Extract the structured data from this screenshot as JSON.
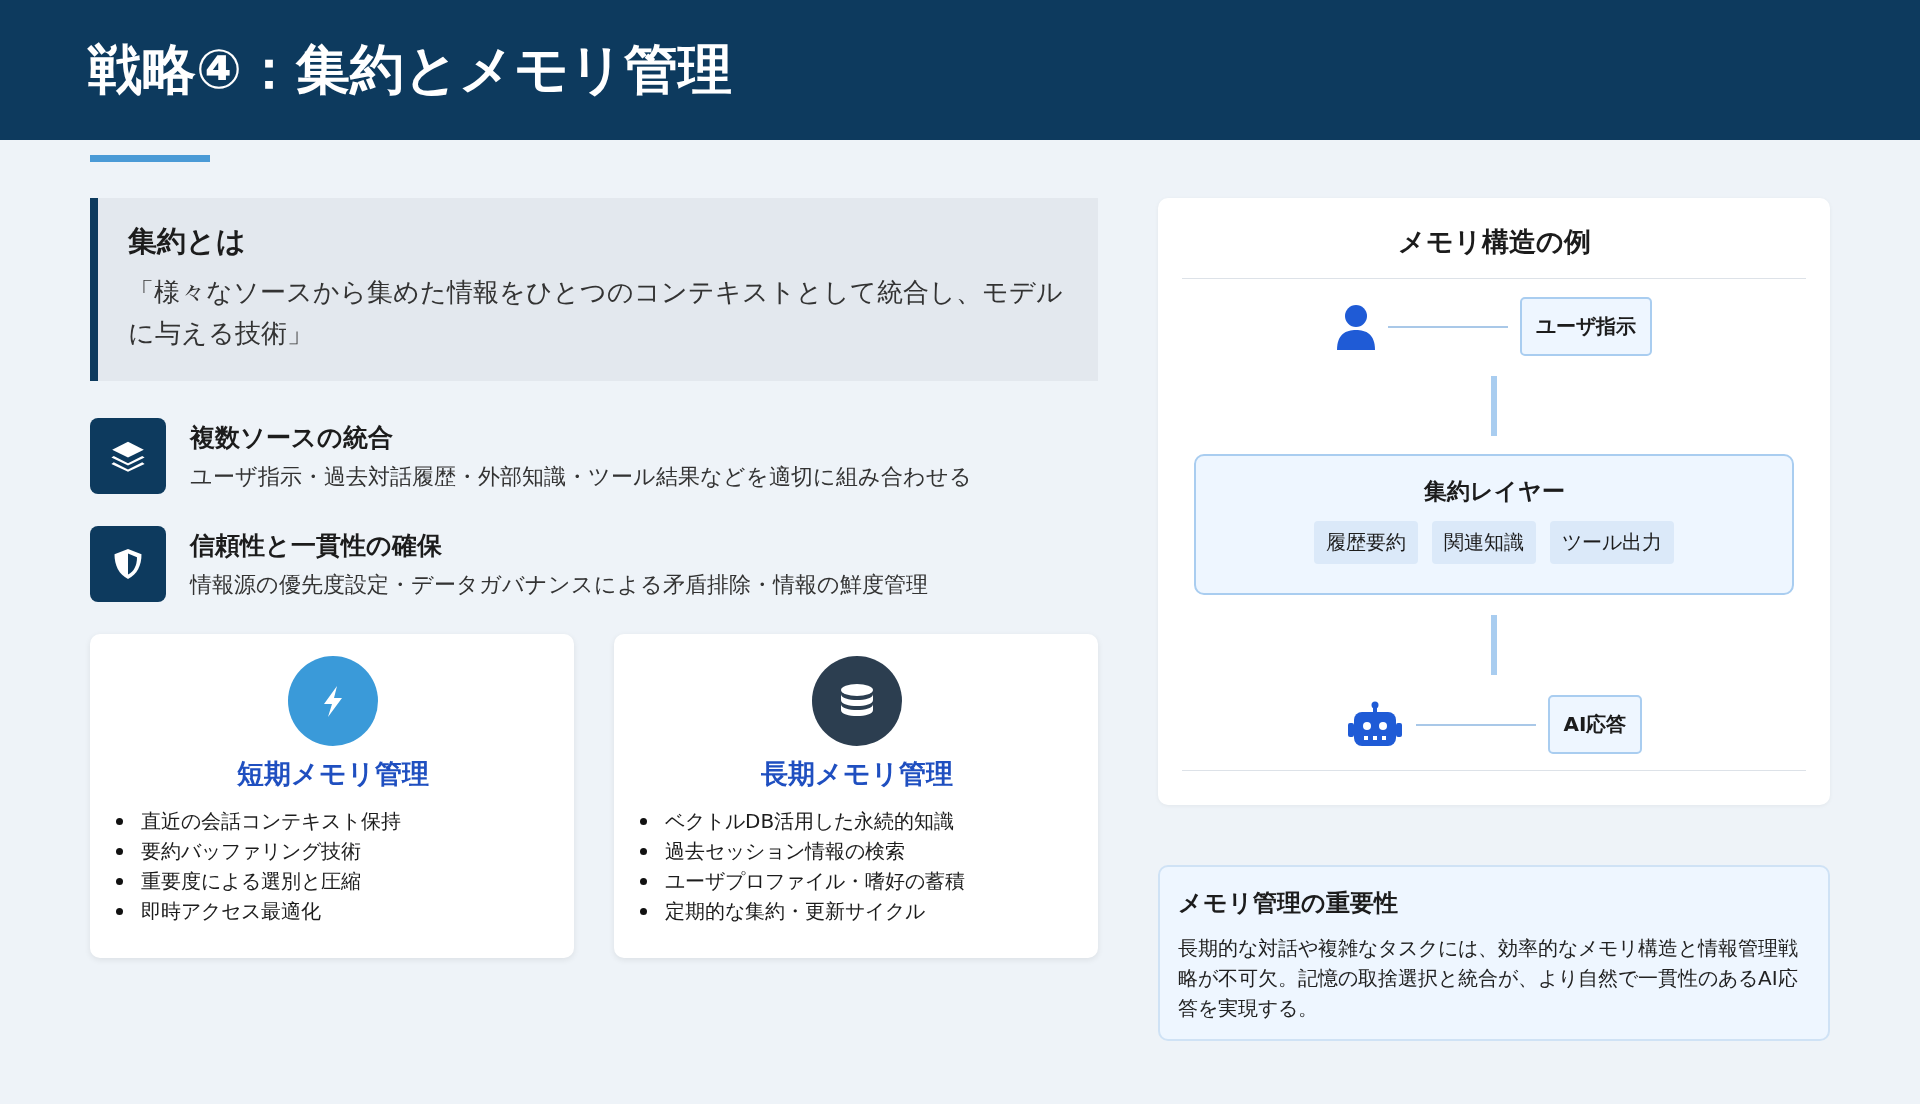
{
  "header": {
    "title": "戦略④：集約とメモリ管理"
  },
  "definition": {
    "heading": "集約とは",
    "text": "「様々なソースから集めた情報をひとつのコンテキストとして統合し、モデルに与える技術」"
  },
  "features": [
    {
      "kind": "layers",
      "title": "複数ソースの統合",
      "text": "ユーザ指示・過去対話履歴・外部知識・ツール結果などを適切に組み合わせる"
    },
    {
      "kind": "shield",
      "title": "信頼性と一貫性の確保",
      "text": "情報源の優先度設定・データガバナンスによる矛盾排除・情報の鮮度管理"
    }
  ],
  "memory_cards": [
    {
      "kind": "short",
      "title": "短期メモリ管理",
      "items": [
        "直近の会話コンテキスト保持",
        "要約バッファリング技術",
        "重要度による選別と圧縮",
        "即時アクセス最適化"
      ]
    },
    {
      "kind": "long",
      "title": "長期メモリ管理",
      "items": [
        "ベクトルDB活用した永続的知識",
        "過去セッション情報の検索",
        "ユーザプロファイル・嗜好の蓄積",
        "定期的な集約・更新サイクル"
      ]
    }
  ],
  "diagram": {
    "title": "メモリ構造の例",
    "user_label": "ユーザ指示",
    "layer": {
      "title": "集約レイヤー",
      "tags": [
        "履歴要約",
        "関連知識",
        "ツール出力"
      ]
    },
    "ai_label": "AI応答"
  },
  "importance": {
    "title": "メモリ管理の重要性",
    "text": "長期的な対話や複雑なタスクには、効率的なメモリ構造と情報管理戦略が不可欠。記憶の取捨選択と統合が、より自然で一貫性のあるAI応答を実現する。"
  }
}
